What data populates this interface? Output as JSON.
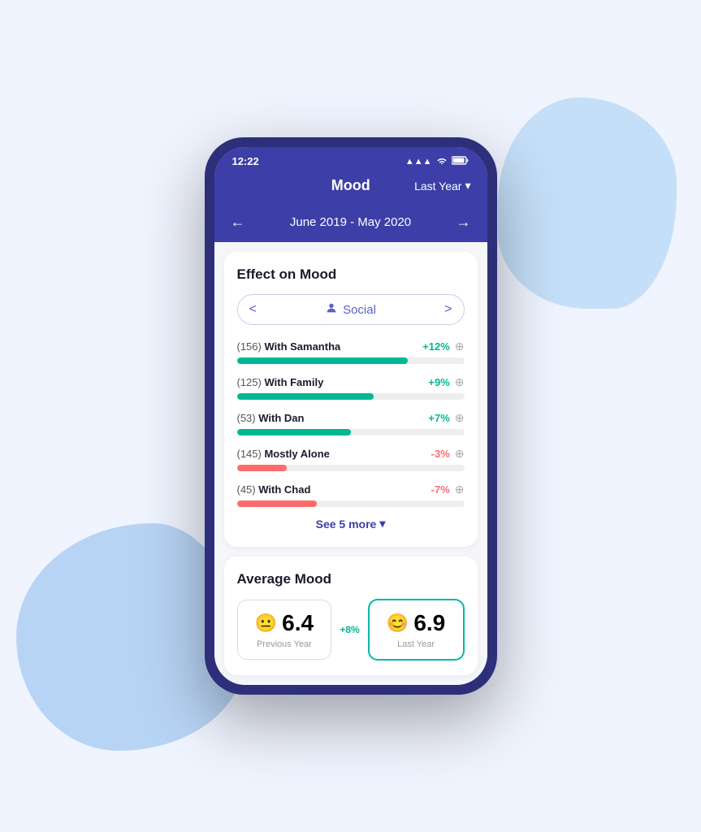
{
  "scene": {
    "status_bar": {
      "time": "12:22",
      "signal": "▲▲▲",
      "wifi": "wifi",
      "battery": "battery"
    },
    "header": {
      "title": "Mood",
      "period_label": "Last Year",
      "chevron": "▾"
    },
    "nav": {
      "left_arrow": "←",
      "date_range": "June 2019 - May 2020",
      "right_arrow": "→"
    },
    "effect_card": {
      "title": "Effect on Mood",
      "category": {
        "left_chevron": "<",
        "icon": "👤",
        "label": "Social",
        "right_chevron": ">"
      },
      "items": [
        {
          "count": "156",
          "name": "With Samantha",
          "value": "+12%",
          "type": "positive",
          "bar_width": "75"
        },
        {
          "count": "125",
          "name": "With Family",
          "value": "+9%",
          "type": "positive",
          "bar_width": "60"
        },
        {
          "count": "53",
          "name": "With Dan",
          "value": "+7%",
          "type": "positive",
          "bar_width": "50"
        },
        {
          "count": "145",
          "name": "Mostly Alone",
          "value": "-3%",
          "type": "negative",
          "bar_width": "22"
        },
        {
          "count": "45",
          "name": "With Chad",
          "value": "-7%",
          "type": "negative",
          "bar_width": "35"
        }
      ],
      "see_more_label": "See 5 more",
      "see_more_icon": "▾"
    },
    "average_card": {
      "title": "Average Mood",
      "previous": {
        "emoji": "😐",
        "value": "6.4",
        "label": "Previous Year"
      },
      "change": "+8%",
      "current": {
        "emoji": "😊",
        "value": "6.9",
        "label": "Last Year"
      }
    }
  }
}
